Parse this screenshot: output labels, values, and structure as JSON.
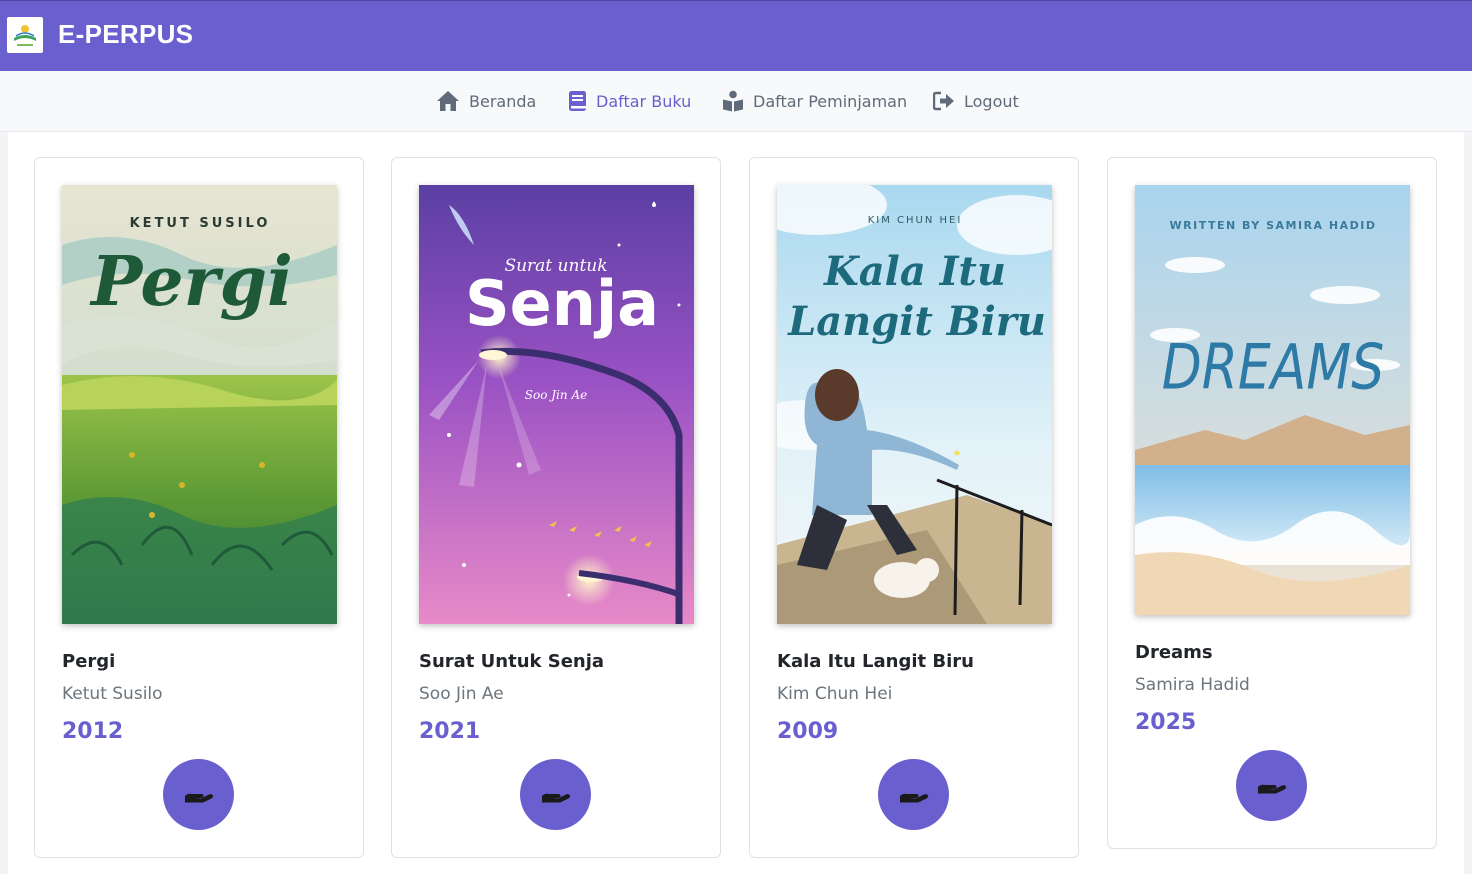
{
  "app": {
    "title": "E-PERPUS",
    "logo_icon": "library-logo-icon"
  },
  "nav": {
    "items": [
      {
        "label": "Beranda",
        "icon": "home-icon",
        "active": false
      },
      {
        "label": "Daftar Buku",
        "icon": "book-icon",
        "active": true
      },
      {
        "label": "Daftar Peminjaman",
        "icon": "book-reader-icon",
        "active": false
      },
      {
        "label": "Logout",
        "icon": "sign-out-icon",
        "active": false
      }
    ]
  },
  "colors": {
    "primary": "#6a5fcf",
    "nav_text": "#5f6b78",
    "muted": "#6c757d"
  },
  "books": [
    {
      "title": "Pergi",
      "author": "Ketut Susilo",
      "year": "2012",
      "cover": {
        "author_text": "KETUT SUSILO",
        "title_text": "Pergi"
      },
      "action_icon": "hand-holding-icon"
    },
    {
      "title": "Surat Untuk Senja",
      "author": "Soo Jin Ae",
      "year": "2021",
      "cover": {
        "subtitle_text": "Surat untuk",
        "title_text": "Senja",
        "author_text": "Soo Jin Ae"
      },
      "action_icon": "hand-holding-icon"
    },
    {
      "title": "Kala Itu Langit Biru",
      "author": "Kim Chun Hei",
      "year": "2009",
      "cover": {
        "author_text": "KIM CHUN HEI",
        "title_line1": "Kala Itu",
        "title_line2": "Langit Biru"
      },
      "action_icon": "hand-holding-icon"
    },
    {
      "title": "Dreams",
      "author": "Samira Hadid",
      "year": "2025",
      "cover": {
        "author_text": "WRITTEN BY SAMIRA HADID",
        "title_text": "DREAMS"
      },
      "action_icon": "hand-holding-icon"
    }
  ]
}
